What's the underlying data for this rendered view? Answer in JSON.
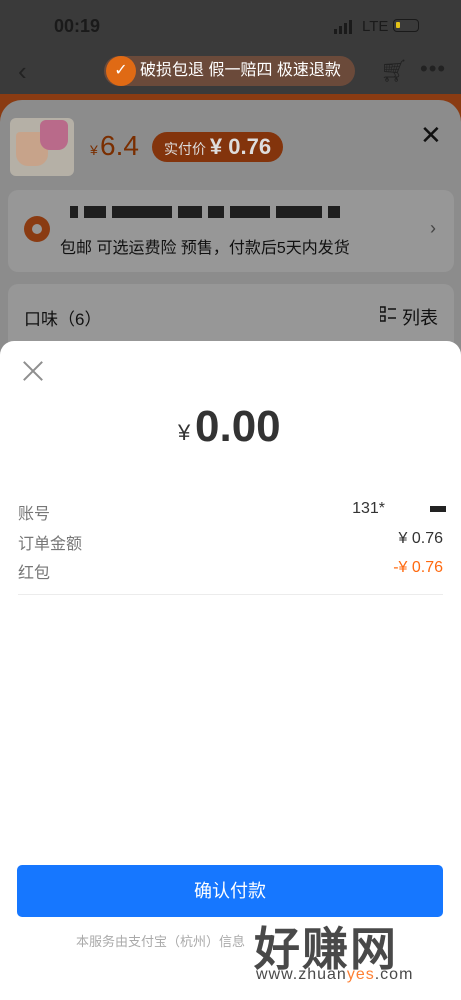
{
  "status": {
    "time": "00:19",
    "network": "LTE"
  },
  "nav": {
    "back_icon": "chevron-left-icon",
    "guarantee": "破损包退 假一赔四 极速退款",
    "cart_icon": "cart-icon",
    "more_icon": "more-dots-icon"
  },
  "product": {
    "currency": "¥",
    "price": "6.4",
    "real_pay_label": "实付价",
    "real_pay_value": "¥ 0.76"
  },
  "shipping": {
    "text": "包邮  可选运费险  预售，付款后5天内发货"
  },
  "flavor": {
    "label": "口味（6）",
    "list_label": "列表"
  },
  "payment": {
    "currency": "¥",
    "amount": "0.00",
    "rows": [
      {
        "label": "账号",
        "value": "131*"
      },
      {
        "label": "订单金额",
        "value": "¥ 0.76"
      },
      {
        "label": "红包",
        "value": "-¥ 0.76"
      }
    ],
    "confirm_label": "确认付款",
    "footer": "本服务由支付宝（杭州）信息"
  },
  "watermark": {
    "title": "好赚网",
    "url_prefix": "www.zhuan",
    "url_highlight": "yes",
    "url_suffix": ".com"
  },
  "colors": {
    "accent": "#1677ff",
    "discount": "#ff6a10"
  }
}
